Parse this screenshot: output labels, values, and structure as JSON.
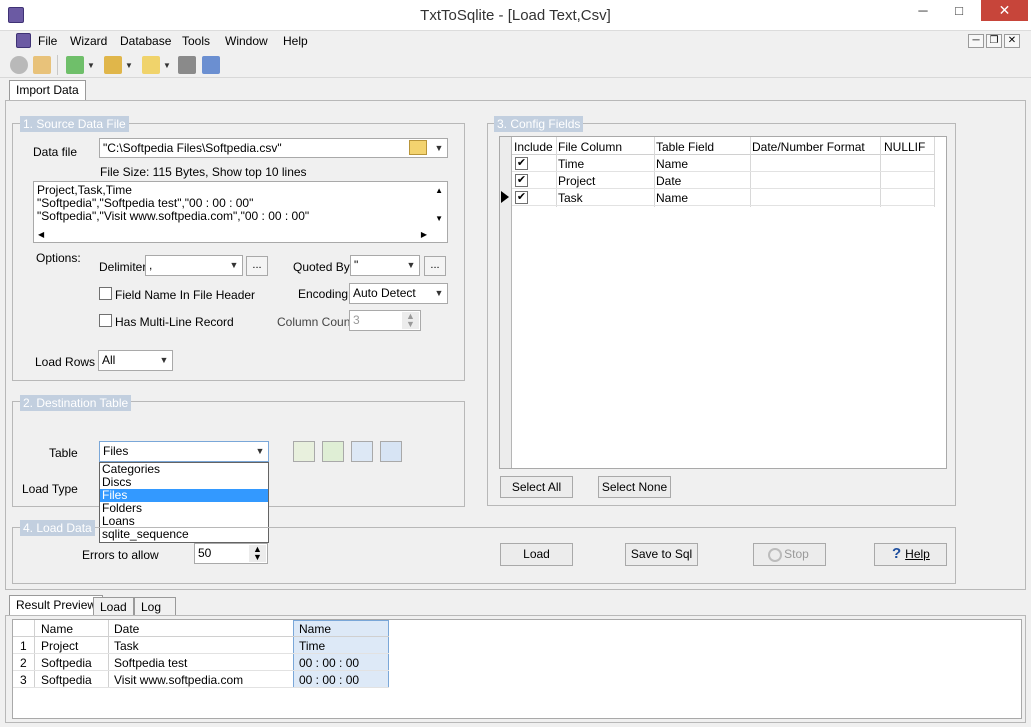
{
  "window": {
    "title": "TxtToSqlite - [Load Text,Csv]",
    "close": "✕",
    "minimize": "─",
    "maximize": "□",
    "restore": "❐"
  },
  "menu": [
    "File",
    "Wizard",
    "Database",
    "Tools",
    "Window",
    "Help"
  ],
  "tabs": {
    "main": "Import Data"
  },
  "source": {
    "legend": "1. Source Data File",
    "data_file_label": "Data file",
    "data_file_value": "\"C:\\Softpedia Files\\Softpedia.csv\"",
    "file_info": "File Size: 115 Bytes,  Show top 10 lines",
    "preview_lines": [
      "Project,Task,Time",
      "\"Softpedia\",\"Softpedia test\",\"00 : 00 : 00\"",
      "\"Softpedia\",\"Visit www.softpedia.com\",\"00 : 00 : 00\""
    ],
    "options_label": "Options:",
    "delimiter_label": "Delimiter",
    "delimiter_value": ",",
    "quoted_by_label": "Quoted By",
    "quoted_by_value": "\"",
    "ellipsis": "...",
    "field_name_header_label": "Field Name In File Header",
    "encoding_label": "Encoding",
    "encoding_value": "Auto Detect",
    "multiline_label": "Has Multi-Line Record",
    "column_count_label": "Column Count",
    "column_count_value": "3",
    "load_rows_label": "Load Rows",
    "load_rows_value": "All"
  },
  "destination": {
    "legend": "2. Destination Table",
    "table_label": "Table",
    "table_value": "Files",
    "load_type_label": "Load Type",
    "dropdown_options": [
      "Categories",
      "Discs",
      "Files",
      "Folders",
      "Loans",
      "sqlite_sequence"
    ],
    "selected_index": 2
  },
  "config": {
    "legend": "3. Config Fields",
    "columns": [
      "Include",
      "File Column",
      "Table Field",
      "Date/Number Format",
      "NULLIF"
    ],
    "rows": [
      {
        "include": true,
        "file_column": "Time",
        "table_field": "Name"
      },
      {
        "include": true,
        "file_column": "Project",
        "table_field": "Date"
      },
      {
        "include": true,
        "file_column": "Task",
        "table_field": "Name"
      }
    ],
    "select_all": "Select All",
    "select_none": "Select None"
  },
  "load": {
    "legend": "4. Load Data",
    "errors_label": "Errors to allow",
    "errors_value": "50",
    "load_button": "Load",
    "save_button": "Save to Sql",
    "stop_button": "Stop",
    "help_button": "Help"
  },
  "result_tabs": [
    "Result Preview",
    "Load",
    "Log"
  ],
  "result": {
    "columns": [
      "Name",
      "Date",
      "Name"
    ],
    "rows": [
      {
        "num": "1",
        "c1": "Project",
        "c2": "Task",
        "c3": "Time"
      },
      {
        "num": "2",
        "c1": "Softpedia",
        "c2": "Softpedia test",
        "c3": "00 : 00 : 00"
      },
      {
        "num": "3",
        "c1": "Softpedia",
        "c2": "Visit www.softpedia.com",
        "c3": "00 : 00 : 00"
      }
    ]
  },
  "colors": {
    "legend_bg": "#c2cfdf",
    "selection": "#3399ff",
    "close_red": "#c7453a",
    "highlight_col": "#dde9f7"
  }
}
